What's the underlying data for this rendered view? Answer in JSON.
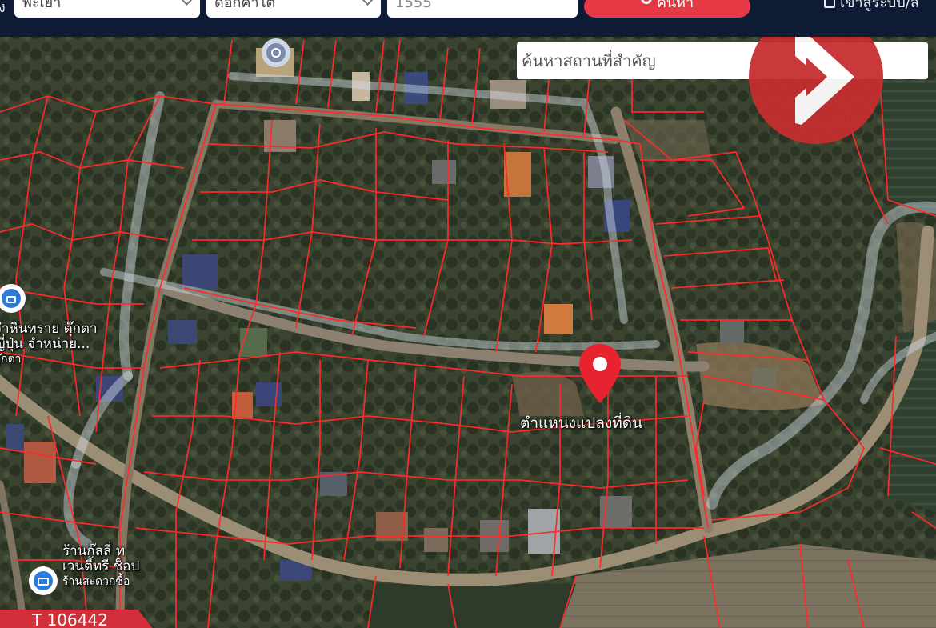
{
  "topbar": {
    "left_edge_text": "ง",
    "province": "พะเยา",
    "district": "ดอกคำใต้",
    "search_value": "1555",
    "search_button_label": "ค้นหา",
    "login_label": "เข้าสู่ระบบ/ล"
  },
  "map": {
    "place_search_placeholder": "ค้นหาสถานที่สำคัญ",
    "plot_marker_label": "ตำแหน่งแปลงที่ดิน",
    "poi_shop_1": {
      "line1": "จำหินทราย ตุ๊กตา",
      "line2": "ญี่ปุ่น จำหน่าย...",
      "line3": "ตุ๊กตา"
    },
    "poi_shop_2": {
      "line1": "ร้านก๊ลลี่ ท",
      "line2": "เวนตี้ทรี ช็อป",
      "line3": "ร้านสะดวกซื้อ"
    },
    "listing_code": "T 106442",
    "accent_color": "#e63946",
    "parcel_line_color": "#ff2a2a"
  },
  "icons": {
    "brand": "brand-logo-icon",
    "location_pin": "location-pin-icon",
    "shop": "shop-icon",
    "landmark": "landmark-icon",
    "search": "search-icon",
    "lock": "lock-icon"
  }
}
